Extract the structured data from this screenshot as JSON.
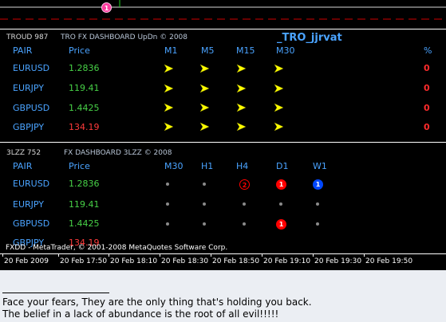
{
  "colors": {
    "background": "#000000",
    "pair_blue": "#4aa3ff",
    "price_green": "#47d147",
    "price_red": "#ff3b3b",
    "arrow_yellow": "#ffff00",
    "signal_red": "#ff0000",
    "signal_blue": "#0047ff",
    "grid_red": "#d10000",
    "axis_white": "#ffffff"
  },
  "top_chart": {
    "marker_label": "1",
    "marker_icon": "circle-signal-icon"
  },
  "panel1": {
    "tag": "TROUD 987",
    "title": "TRO FX DASHBOARD UpDn © 2008",
    "author": "_TRO_jjrvat",
    "headers": {
      "pair": "PAIR",
      "price": "Price",
      "m1": "M1",
      "m5": "M5",
      "m15": "M15",
      "m30": "M30",
      "pct": "%"
    },
    "rows": [
      {
        "pair": "EURUSD",
        "price": "1.2836",
        "price_color": "green",
        "pct": "0",
        "arrows": "yellow-arrow-icon"
      },
      {
        "pair": "EURJPY",
        "price": "119.41",
        "price_color": "green",
        "pct": "0",
        "arrows": "yellow-arrow-icon"
      },
      {
        "pair": "GBPUSD",
        "price": "1.4425",
        "price_color": "green",
        "pct": "0",
        "arrows": "yellow-arrow-icon"
      },
      {
        "pair": "GBPJPY",
        "price": "134.19",
        "price_color": "red",
        "pct": "0",
        "arrows": "yellow-arrow-icon"
      }
    ]
  },
  "panel2": {
    "tag": "3LZZ 752",
    "title": "FX DASHBOARD 3LZZ © 2008",
    "headers": {
      "pair": "PAIR",
      "price": "Price",
      "m30": "M30",
      "h1": "H1",
      "h4": "H4",
      "d1": "D1",
      "w1": "W1"
    },
    "rows": [
      {
        "pair": "EURUSD",
        "price": "1.2836",
        "price_color": "green",
        "cells": [
          "dot",
          "dot",
          "2-red-outline",
          "1-red",
          "1-blue"
        ]
      },
      {
        "pair": "EURJPY",
        "price": "119.41",
        "price_color": "green",
        "cells": [
          "dot",
          "dot",
          "dot",
          "dot",
          "dot"
        ]
      },
      {
        "pair": "GBPUSD",
        "price": "1.4425",
        "price_color": "green",
        "cells": [
          "dot",
          "dot",
          "dot",
          "1-red",
          "dot"
        ]
      },
      {
        "pair": "GBPJPY",
        "price": "134.19",
        "price_color": "red",
        "cells": []
      }
    ],
    "signal_labels": {
      "two": "2",
      "one": "1"
    }
  },
  "copyright": "FXDD - MetaTrader, © 2001-2008 MetaQuotes Software Corp.",
  "time_axis": [
    "20 Feb 2009",
    "20 Feb 17:50",
    "20 Feb 18:10",
    "20 Feb 18:30",
    "20 Feb 18:50",
    "20 Feb 19:10",
    "20 Feb 19:30",
    "20 Feb 19:50"
  ],
  "footer": {
    "line1": "Face your fears, They are the only thing that's holding you back.",
    "line2": "The belief in a lack of abundance is the root of all evil!!!!!"
  }
}
